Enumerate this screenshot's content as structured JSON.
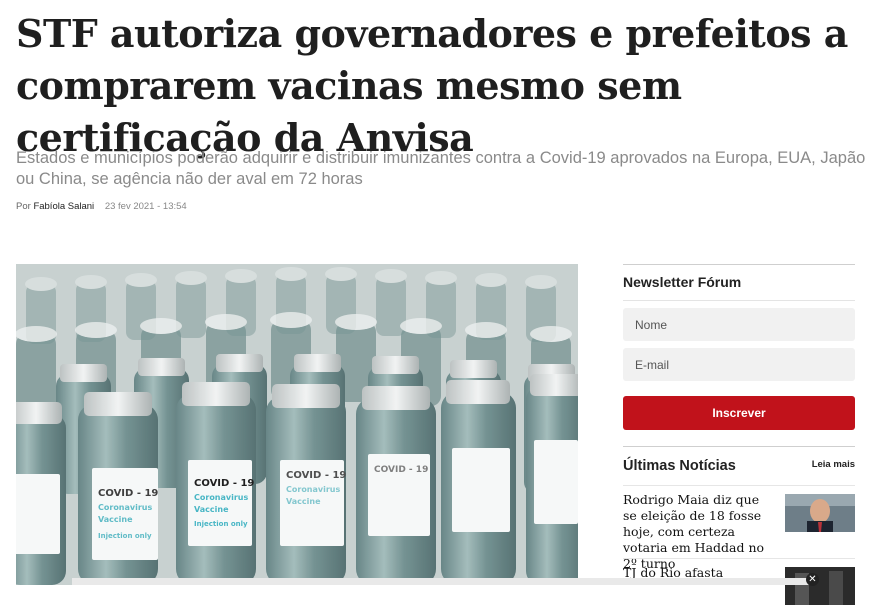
{
  "article": {
    "headline": "STF autoriza governadores e prefeitos a comprarem vacinas mesmo sem certificação da Anvisa",
    "subtitle": "Estados e municípios poderão adquirir e distribuir imunizantes contra a Covid-19 aprovados na Europa, EUA, Japão ou China, se agência não der aval em 72 horas",
    "byline_prefix": "Por",
    "author": "Fabíola Salani",
    "date": "23 fev 2021 - 13:54",
    "hero_image": {
      "vial_label_main": "COVID - 19",
      "vial_label_sub1": "Coronavirus",
      "vial_label_sub2": "Vaccine",
      "vial_label_sub3": "Injection only"
    }
  },
  "newsletter": {
    "title": "Newsletter Fórum",
    "name_placeholder": "Nome",
    "email_placeholder": "E-mail",
    "button_label": "Inscrever"
  },
  "latest": {
    "title": "Últimas Notícias",
    "more_link": "Leia mais",
    "items": [
      {
        "text": "Rodrigo Maia diz que se eleição de 18 fosse hoje, com certeza votaria em Haddad no 2º turno"
      },
      {
        "text": "TJ do Rio afasta"
      }
    ]
  },
  "colors": {
    "accent": "#c1121b",
    "subtitle": "#8a8a8a"
  }
}
